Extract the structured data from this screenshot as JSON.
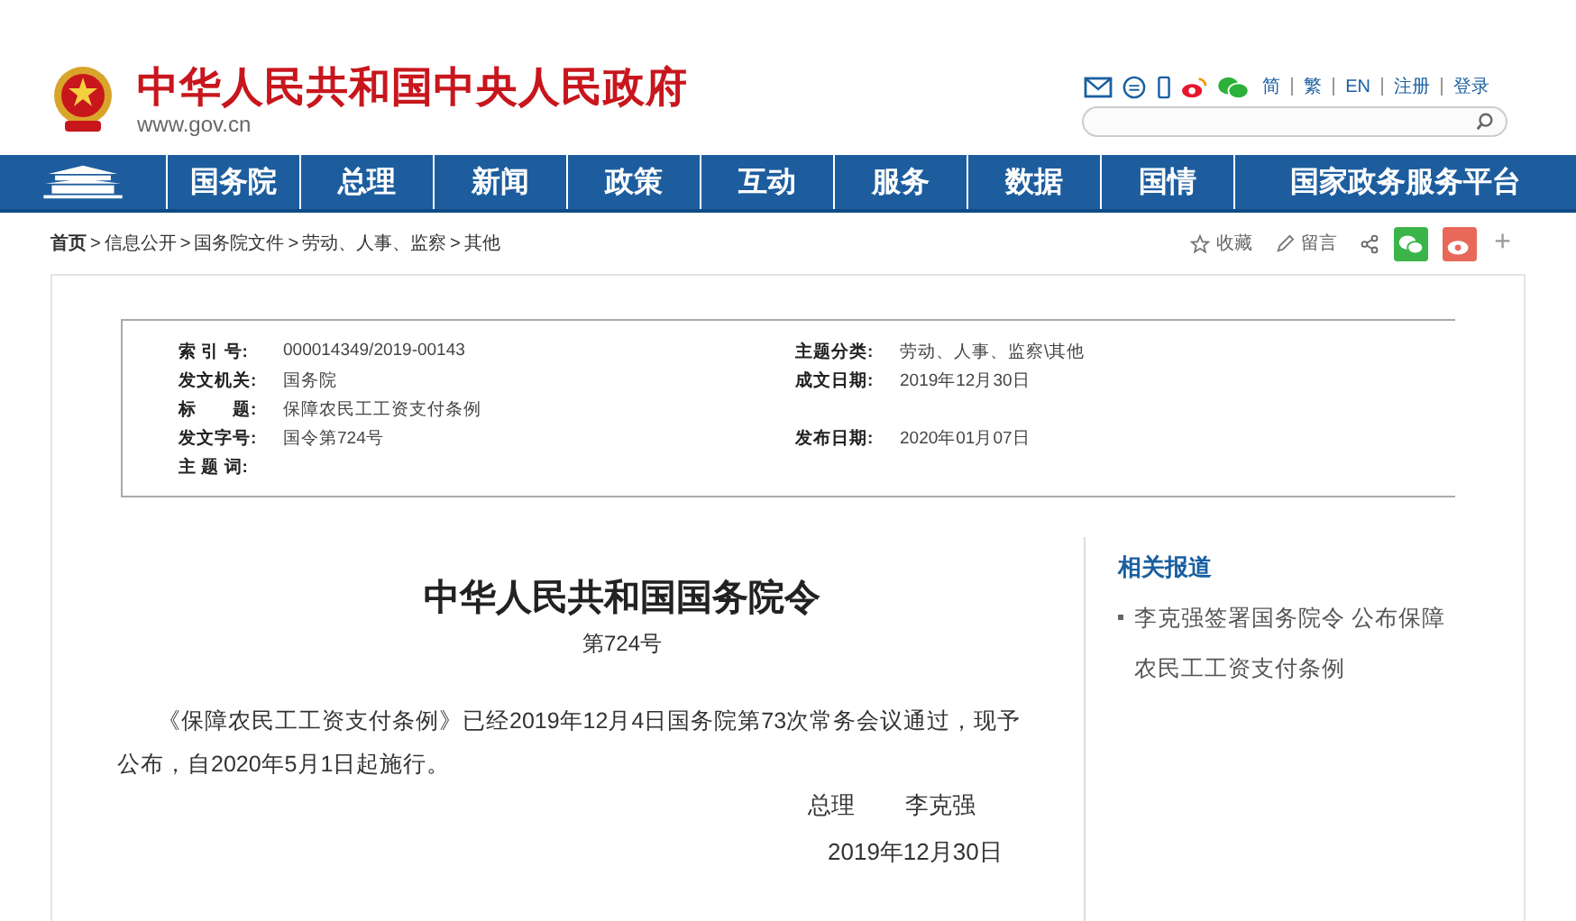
{
  "header": {
    "site_title": "中华人民共和国中央人民政府",
    "domain": "www.gov.cn",
    "links": [
      "简",
      "繁",
      "EN",
      "注册",
      "登录"
    ]
  },
  "nav": {
    "items": [
      "国务院",
      "总理",
      "新闻",
      "政策",
      "互动",
      "服务",
      "数据",
      "国情",
      "国家政务服务平台"
    ]
  },
  "breadcrumb": [
    {
      "label": "首页"
    },
    {
      "separator": ">",
      "label": "信息公开"
    },
    {
      "separator": ">",
      "label": "国务院文件"
    },
    {
      "separator": ">",
      "label": "劳动、人事、监察"
    },
    {
      "separator": ">",
      "label": "其他"
    }
  ],
  "tools": {
    "favorite": "收藏",
    "message": "留言",
    "plus": "+"
  },
  "meta": {
    "rows": [
      {
        "cells": [
          {
            "label": "索 引 号:",
            "value": "000014349/2019-00143"
          },
          {
            "label": "主题分类:",
            "value": "劳动、人事、监察\\其他"
          }
        ]
      },
      {
        "cells": [
          {
            "label": "发文机关:",
            "value": "国务院"
          },
          {
            "label": "成文日期:",
            "value": "2019年12月30日"
          }
        ]
      },
      {
        "cells": [
          {
            "label": "标　　题:",
            "value": "保障农民工工资支付条例"
          }
        ]
      },
      {
        "cells": [
          {
            "label": "发文字号:",
            "value": "国令第724号"
          },
          {
            "label": "发布日期:",
            "value": "2020年01月07日"
          }
        ]
      },
      {
        "cells": [
          {
            "label": "主 题 词:"
          }
        ]
      }
    ]
  },
  "article": {
    "title": "中华人民共和国国务院令",
    "number": "第724号",
    "body": "《保障农民工工资支付条例》已经2019年12月4日国务院第73次常务会议通过，现予公布，自2020年5月1日起施行。",
    "signer_title": "总理",
    "signer": "李克强",
    "date": "2019年12月30日"
  },
  "related": {
    "heading": "相关报道",
    "items": [
      "李克强签署国务院令 公布保障农民工工资支付条例"
    ]
  }
}
